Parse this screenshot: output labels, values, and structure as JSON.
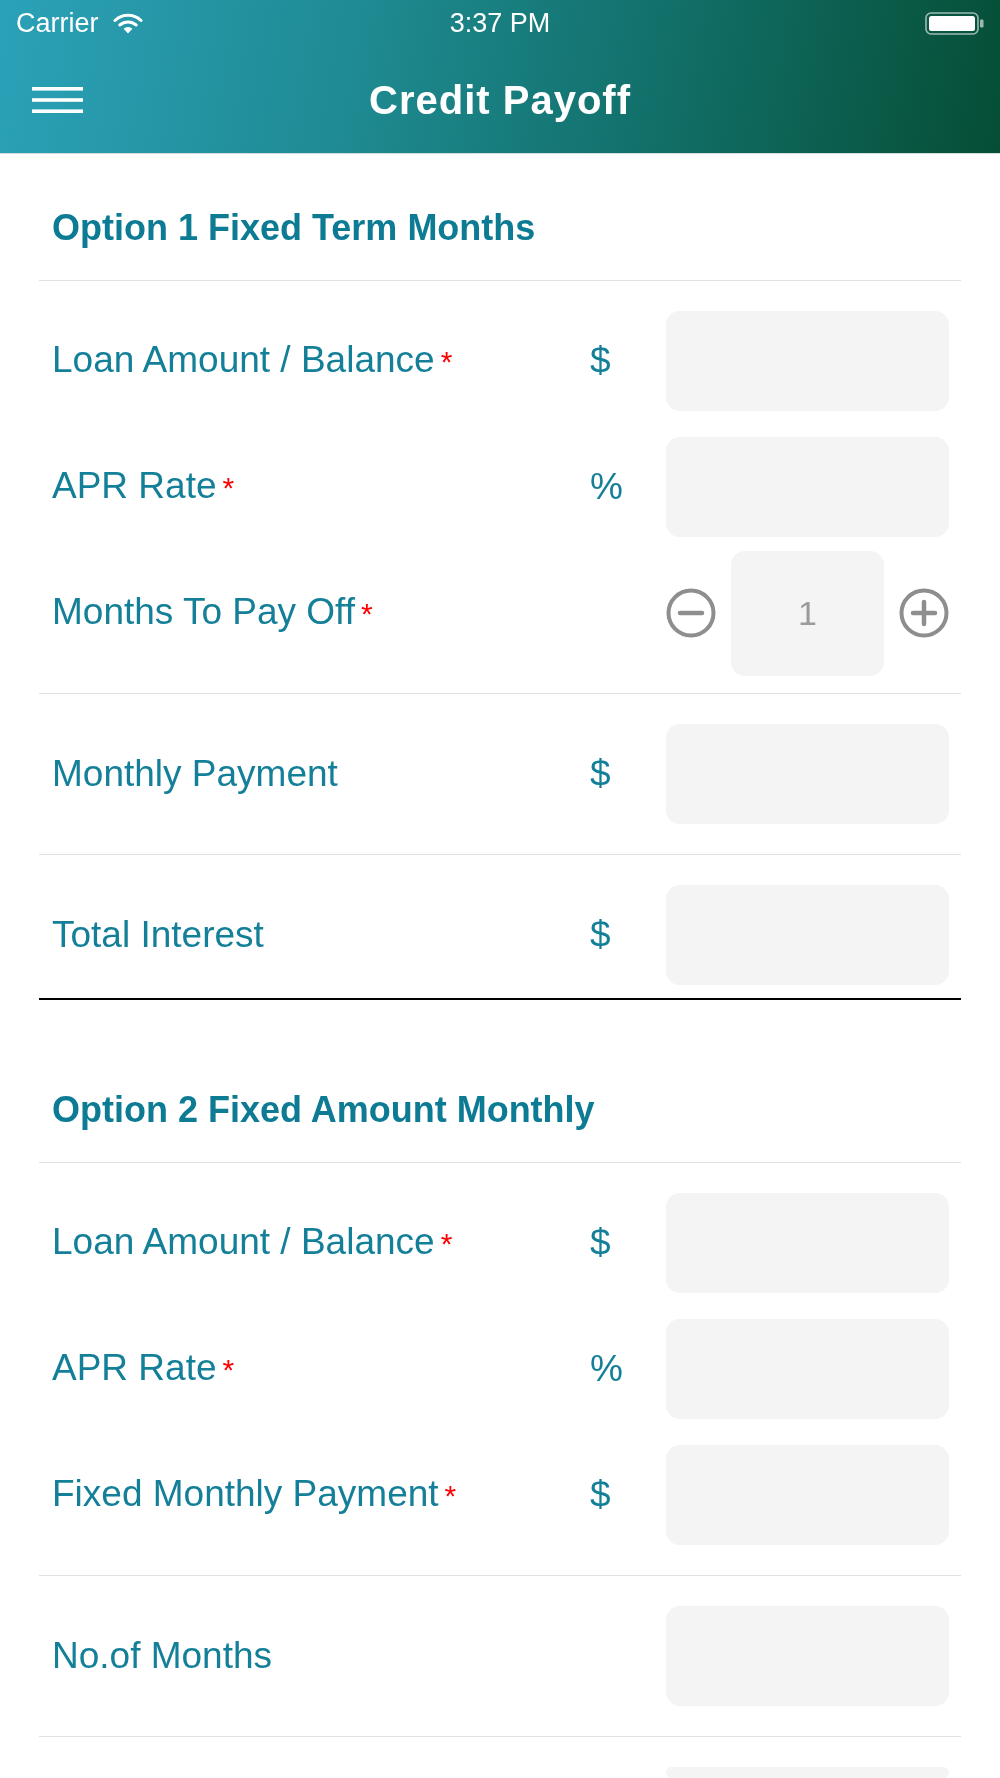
{
  "status_bar": {
    "carrier": "Carrier",
    "time": "3:37 PM"
  },
  "nav_bar": {
    "title": "Credit Payoff"
  },
  "sections": [
    {
      "title": "Option 1 Fixed Term Months",
      "groups": [
        {
          "rows": [
            {
              "kind": "input",
              "label": "Loan Amount / Balance",
              "required_mark": "*",
              "unit": "$"
            },
            {
              "kind": "input",
              "label": "APR Rate",
              "required_mark": "*",
              "unit": "%"
            },
            {
              "kind": "stepper",
              "label": "Months To Pay Off",
              "required_mark": "*",
              "value": "1"
            }
          ]
        },
        {
          "rows": [
            {
              "kind": "input",
              "label": "Monthly Payment",
              "unit": "$"
            }
          ]
        },
        {
          "rows": [
            {
              "kind": "input",
              "label": "Total Interest",
              "unit": "$"
            }
          ]
        }
      ]
    },
    {
      "title": "Option 2 Fixed Amount Monthly",
      "groups": [
        {
          "rows": [
            {
              "kind": "input",
              "label": "Loan Amount / Balance",
              "required_mark": "*",
              "unit": "$"
            },
            {
              "kind": "input",
              "label": "APR Rate",
              "required_mark": "*",
              "unit": "%"
            },
            {
              "kind": "input",
              "label": "Fixed Monthly Payment",
              "required_mark": "*",
              "unit": "$"
            }
          ]
        },
        {
          "rows": [
            {
              "kind": "input",
              "label": "No.of Months"
            }
          ]
        },
        {
          "rows": [
            {
              "kind": "input"
            }
          ]
        }
      ]
    }
  ]
}
